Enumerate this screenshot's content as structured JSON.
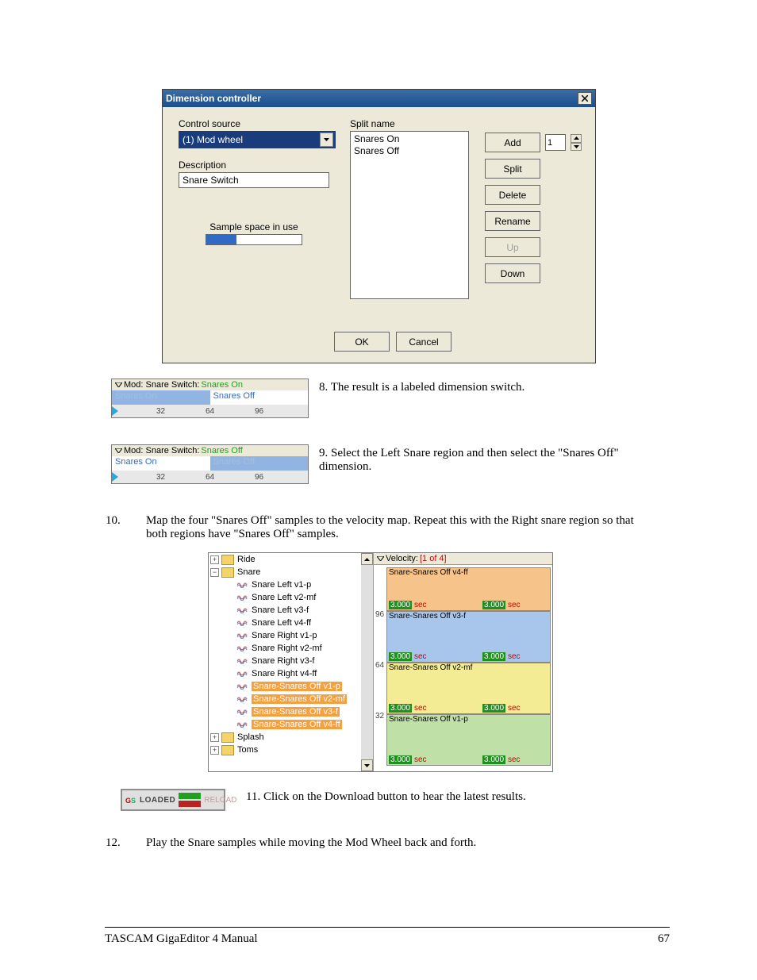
{
  "dialog": {
    "title": "Dimension controller",
    "control_source_label": "Control source",
    "control_source_value": "(1) Mod wheel",
    "description_label": "Description",
    "description_value": "Snare Switch",
    "sample_space_label": "Sample space in use",
    "split_name_label": "Split name",
    "split_items": [
      "Snares On",
      "Snares Off"
    ],
    "buttons": {
      "add": "Add",
      "split": "Split",
      "delete": "Delete",
      "rename": "Rename",
      "up": "Up",
      "down": "Down",
      "ok": "OK",
      "cancel": "Cancel"
    },
    "spin_value": "1"
  },
  "step8": {
    "text": "8. The result is a labeled dimension switch.",
    "mod_label": "Mod: Snare Switch:",
    "mod_active": "Snares On",
    "left": "Snares On",
    "right": "Snares Off",
    "ticks": [
      "32",
      "64",
      "96"
    ]
  },
  "step9": {
    "text": "9. Select the Left Snare region and then select the \"Snares Off\" dimension.",
    "mod_label": "Mod: Snare Switch:",
    "mod_active": "Snares Off",
    "left": "Snares On",
    "right": "Snares Off",
    "ticks": [
      "32",
      "64",
      "96"
    ]
  },
  "step10": {
    "num": "10.",
    "text": "Map the four \"Snares Off\" samples to the velocity map.  Repeat this with the Right snare region so that both regions have \"Snares Off\" samples."
  },
  "tree": {
    "ride": "Ride",
    "snare": "Snare",
    "items": [
      "Snare Left v1-p",
      "Snare Left v2-mf",
      "Snare Left v3-f",
      "Snare Left v4-ff",
      "Snare Right v1-p",
      "Snare Right v2-mf",
      "Snare Right v3-f",
      "Snare Right v4-ff"
    ],
    "sel_items": [
      "Snare-Snares Off v1-p",
      "Snare-Snares Off v2-mf",
      "Snare-Snares Off v3-f",
      "Snare-Snares Off v4-ff"
    ],
    "splash": "Splash",
    "toms": "Toms"
  },
  "velocity": {
    "header_label": "Velocity:",
    "header_count": "[1 of 4]",
    "bands": [
      {
        "name": "Snare-Snares Off v4-ff"
      },
      {
        "name": "Snare-Snares Off v3-f"
      },
      {
        "name": "Snare-Snares Off v2-mf"
      },
      {
        "name": "Snare-Snares Off v1-p"
      }
    ],
    "ticks": [
      "96",
      "64",
      "32"
    ],
    "sec_g": "3.000",
    "sec_r": "sec"
  },
  "loaded": {
    "label": "LOADED",
    "reload": "RELOAD"
  },
  "step11": {
    "text": "11. Click on the Download button to hear the latest results."
  },
  "step12": {
    "num": "12.",
    "text": "Play the Snare samples while moving the Mod Wheel back and forth."
  },
  "footer": {
    "left": "TASCAM GigaEditor 4 Manual",
    "right": "67"
  }
}
